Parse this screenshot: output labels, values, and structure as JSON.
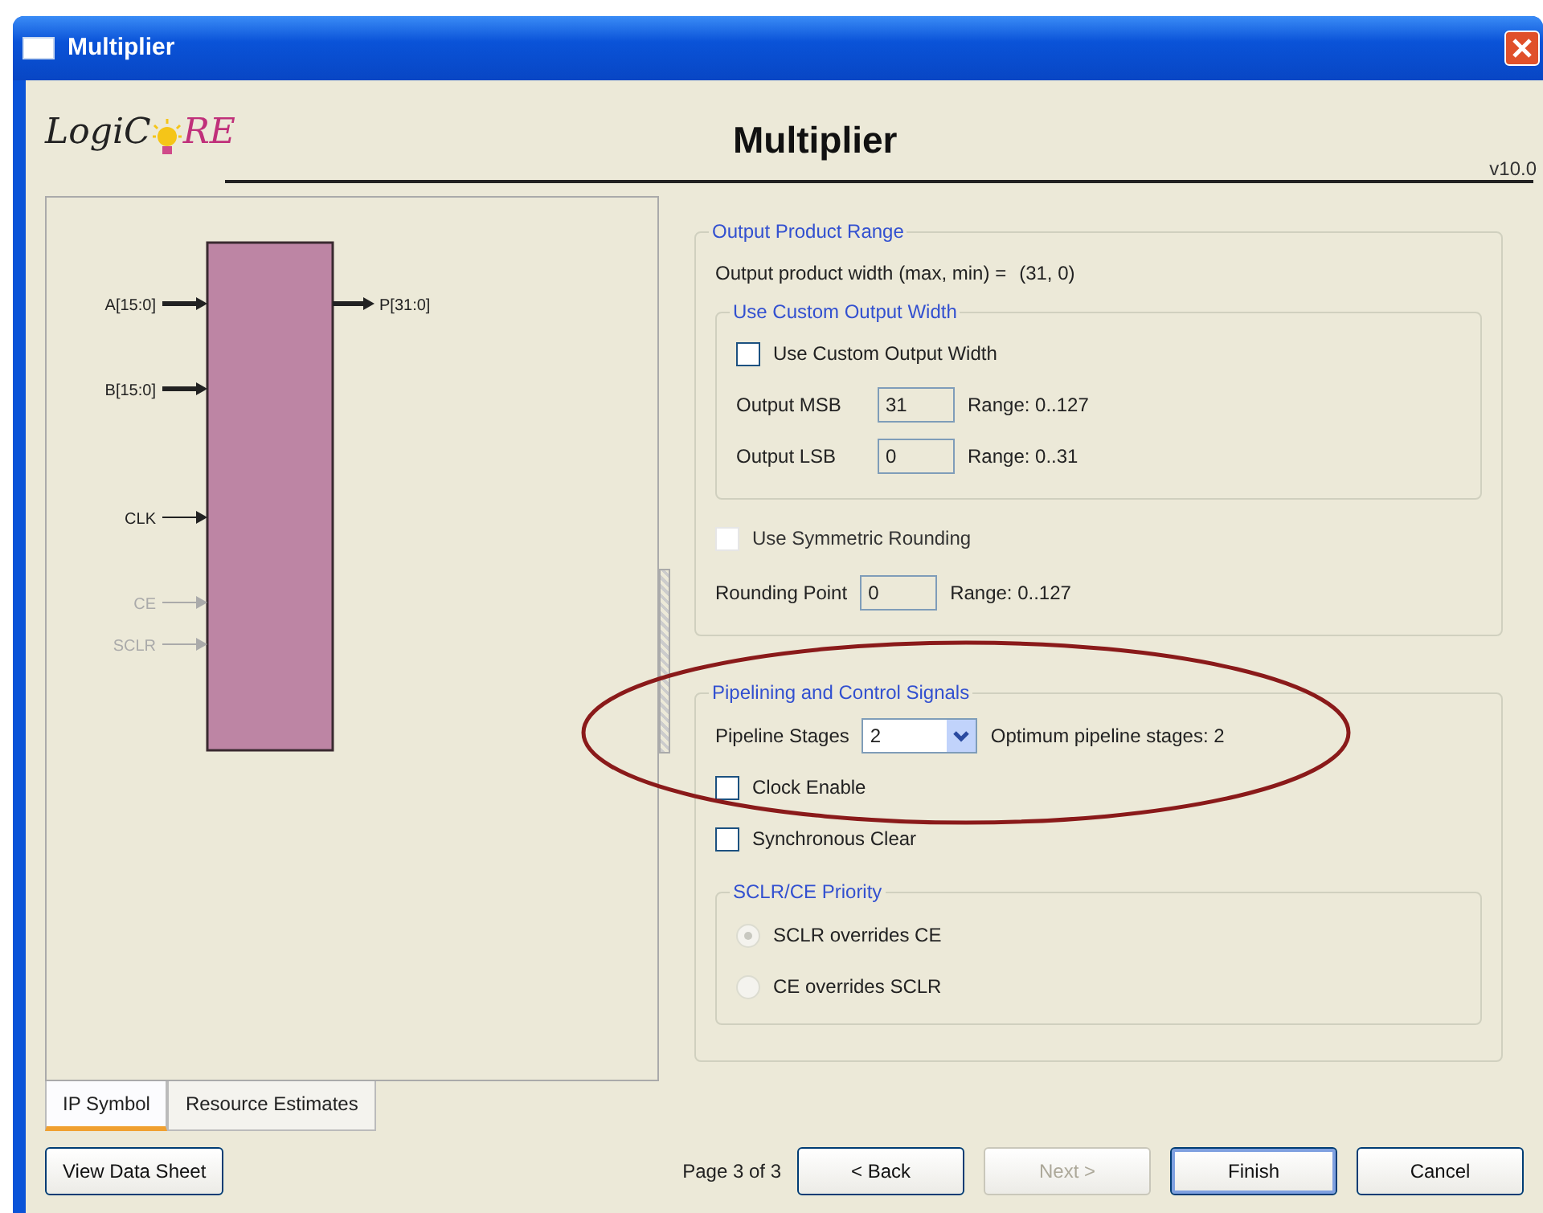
{
  "window": {
    "title": "Multiplier"
  },
  "header": {
    "logo": {
      "left": "LogiC",
      "right": "RE"
    },
    "title": "Multiplier",
    "version": "v10.0"
  },
  "symbol": {
    "inputs": [
      {
        "label": "A[15:0]",
        "kind": "bus",
        "enabled": true
      },
      {
        "label": "B[15:0]",
        "kind": "bus",
        "enabled": true
      },
      {
        "label": "CLK",
        "kind": "clock",
        "enabled": true
      },
      {
        "label": "CE",
        "kind": "control",
        "enabled": false
      },
      {
        "label": "SCLR",
        "kind": "control",
        "enabled": false
      }
    ],
    "outputs": [
      {
        "label": "P[31:0]",
        "kind": "bus",
        "enabled": true
      }
    ]
  },
  "tabs": [
    {
      "label": "IP Symbol",
      "selected": true
    },
    {
      "label": "Resource Estimates",
      "selected": false
    }
  ],
  "output_product_range": {
    "legend": "Output Product Range",
    "width_label": "Output product width (max, min)  =",
    "width_value": "(31, 0)",
    "custom_width": {
      "legend": "Use Custom Output Width",
      "checkbox": {
        "label": "Use Custom Output Width",
        "checked": false
      },
      "fields": [
        {
          "label": "Output MSB",
          "value": "31",
          "range": "Range: 0..127",
          "disabled": true
        },
        {
          "label": "Output LSB",
          "value": "0",
          "range": "Range: 0..31",
          "disabled": true
        }
      ]
    },
    "symmetric_rounding": {
      "label": "Use Symmetric Rounding",
      "checked": false,
      "disabled": true
    },
    "rounding_point": {
      "label": "Rounding Point",
      "value": "0",
      "range": "Range: 0..127",
      "disabled": true
    }
  },
  "pipelining": {
    "legend": "Pipelining and Control Signals",
    "stages": {
      "label": "Pipeline Stages",
      "value": "2"
    },
    "optimum": "Optimum pipeline stages:  2",
    "options": [
      {
        "label": "Clock Enable",
        "checked": false
      },
      {
        "label": "Synchronous Clear",
        "checked": false
      }
    ],
    "priority": {
      "legend": "SCLR/CE Priority",
      "disabled": true,
      "options": [
        {
          "label": "SCLR overrides CE",
          "selected": true
        },
        {
          "label": "CE overrides SCLR",
          "selected": false
        }
      ]
    }
  },
  "footer": {
    "datasheet": "View Data Sheet",
    "page": "Page 3 of 3",
    "buttons": [
      {
        "label": "< Back",
        "disabled": false,
        "default": false
      },
      {
        "label": "Next >",
        "disabled": true,
        "default": false
      },
      {
        "label": "Finish",
        "disabled": false,
        "default": true
      },
      {
        "label": "Cancel",
        "disabled": false,
        "default": false
      }
    ]
  }
}
